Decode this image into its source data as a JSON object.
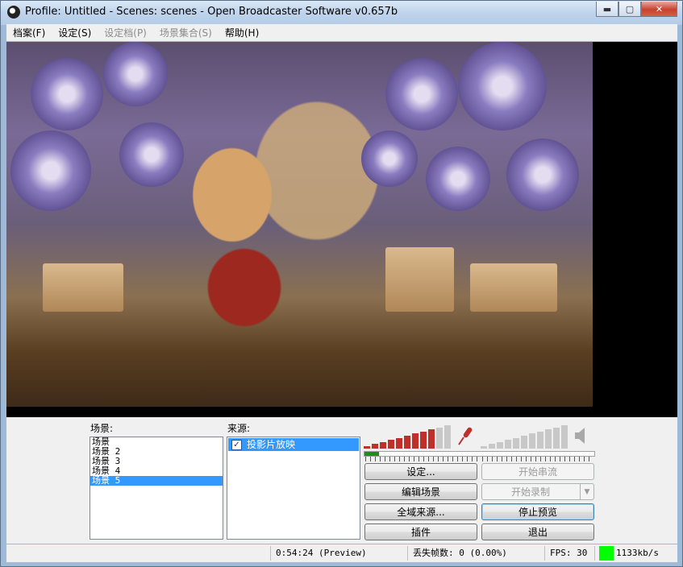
{
  "window": {
    "title": "Profile: Untitled - Scenes: scenes - Open Broadcaster Software v0.657b",
    "minimize": "▬",
    "maximize": "▢",
    "close": "✕"
  },
  "menu": {
    "items": [
      "档案(F)",
      "设定(S)",
      "设定档(P)",
      "场景集合(S)",
      "帮助(H)"
    ]
  },
  "scenes": {
    "label": "场景:",
    "items": [
      "场景",
      "场景 2",
      "场景 3",
      "场景 4",
      "场景 5"
    ],
    "selected_index": 4
  },
  "sources": {
    "label": "来源:",
    "items": [
      {
        "name": "投影片放映",
        "checked": true
      }
    ]
  },
  "audio": {
    "mic_level_bars_active": 9,
    "desktop_level_bars_active": 0,
    "mic_icon": "microphone-icon",
    "speaker_icon": "speaker-icon"
  },
  "buttons": {
    "settings": "设定...",
    "edit_scene": "编辑场景",
    "global_sources": "全域来源...",
    "plugins": "插件",
    "start_streaming": "开始串流",
    "start_recording": "开始录制",
    "stop_preview": "停止预览",
    "exit": "退出"
  },
  "status": {
    "time": "0:54:24 (Preview)",
    "dropped_frames": "丢失帧数: 0 (0.00%)",
    "fps": "FPS: 30",
    "bitrate": "1133kb/s",
    "bitrate_color": "#00ff00"
  }
}
